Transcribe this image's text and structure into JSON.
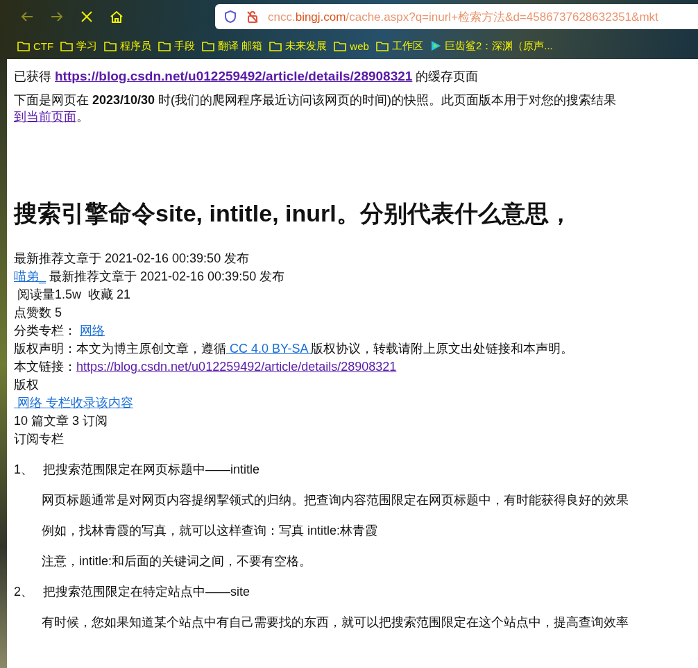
{
  "browser": {
    "url": {
      "prefix": "cncc.",
      "domain": "bingj.com",
      "rest": "/cache.aspx?q=inurl+检索方法&d=4586737628632351&mkt"
    },
    "bookmarks": [
      {
        "label": "CTF",
        "kind": "folder"
      },
      {
        "label": "学习",
        "kind": "folder"
      },
      {
        "label": "程序员",
        "kind": "folder"
      },
      {
        "label": "手段",
        "kind": "folder"
      },
      {
        "label": "翻译 邮箱",
        "kind": "folder"
      },
      {
        "label": "未来发展",
        "kind": "folder"
      },
      {
        "label": "web",
        "kind": "folder"
      },
      {
        "label": "工作区",
        "kind": "folder"
      },
      {
        "label": "巨齿鲨2：深渊（原声...",
        "kind": "video"
      }
    ]
  },
  "cache_notice": {
    "prefix": "已获得",
    "url": "https://blog.csdn.net/u012259492/article/details/28908321",
    "suffix": "的缓存页面"
  },
  "snapshot_notice": {
    "text": "下面是网页在 **2023/10/30** 时(我们的爬网程序最近访问该网页的时间)的快照。此页面版本用于对您的搜索结果",
    "link": "到当前页面",
    "tail": "。"
  },
  "article": {
    "title": "搜索引擎命令site, intitle, inurl。分别代表什么意思，",
    "meta": [
      [
        {
          "text": "最新推荐文章于 2021-02-16 00:39:50 发布",
          "link": false
        }
      ],
      [
        {
          "text": "喵弟_",
          "link": true
        },
        {
          "text": " 最新推荐文章于 2021-02-16 00:39:50 发布",
          "link": false
        }
      ],
      [
        {
          "text": " 阅读量1.5w  收藏 21",
          "link": false
        }
      ],
      [
        {
          "text": "点赞数 5",
          "link": false
        }
      ],
      [
        {
          "text": "分类专栏： ",
          "link": false
        },
        {
          "text": "网络",
          "link": true
        }
      ],
      [
        {
          "text": "版权声明：本文为博主原创文章，遵循",
          "link": false
        },
        {
          "text": " CC 4.0 BY-SA ",
          "link": true
        },
        {
          "text": "版权协议，转载请附上原文出处链接和本声明。",
          "link": false
        }
      ],
      [
        {
          "text": "本文链接：",
          "link": false
        },
        {
          "text": "https://blog.csdn.net/u012259492/article/details/28908321",
          "link": true,
          "visited": true
        }
      ],
      [
        {
          "text": "版权",
          "link": false
        }
      ],
      [
        {
          "text": " 网络 专栏收录该内容",
          "link": true
        }
      ],
      [
        {
          "text": "10 篇文章 3 订阅",
          "link": false
        }
      ],
      [
        {
          "text": "订阅专栏",
          "link": false
        }
      ]
    ],
    "sections": [
      {
        "number": "1、",
        "heading": "把搜索范围限定在网页标题中——intitle",
        "paragraphs": [
          "网页标题通常是对网页内容提纲挈领式的归纳。把查询内容范围限定在网页标题中，有时能获得良好的效果",
          "例如，找林青霞的写真，就可以这样查询：写真 intitle:林青霞",
          "注意，intitle:和后面的关键词之间，不要有空格。"
        ]
      },
      {
        "number": "2、",
        "heading": "把搜索范围限定在特定站点中——site",
        "paragraphs": [
          "有时候，您如果知道某个站点中有自己需要找的东西，就可以把搜索范围限定在这个站点中，提高查询效率"
        ]
      }
    ]
  }
}
